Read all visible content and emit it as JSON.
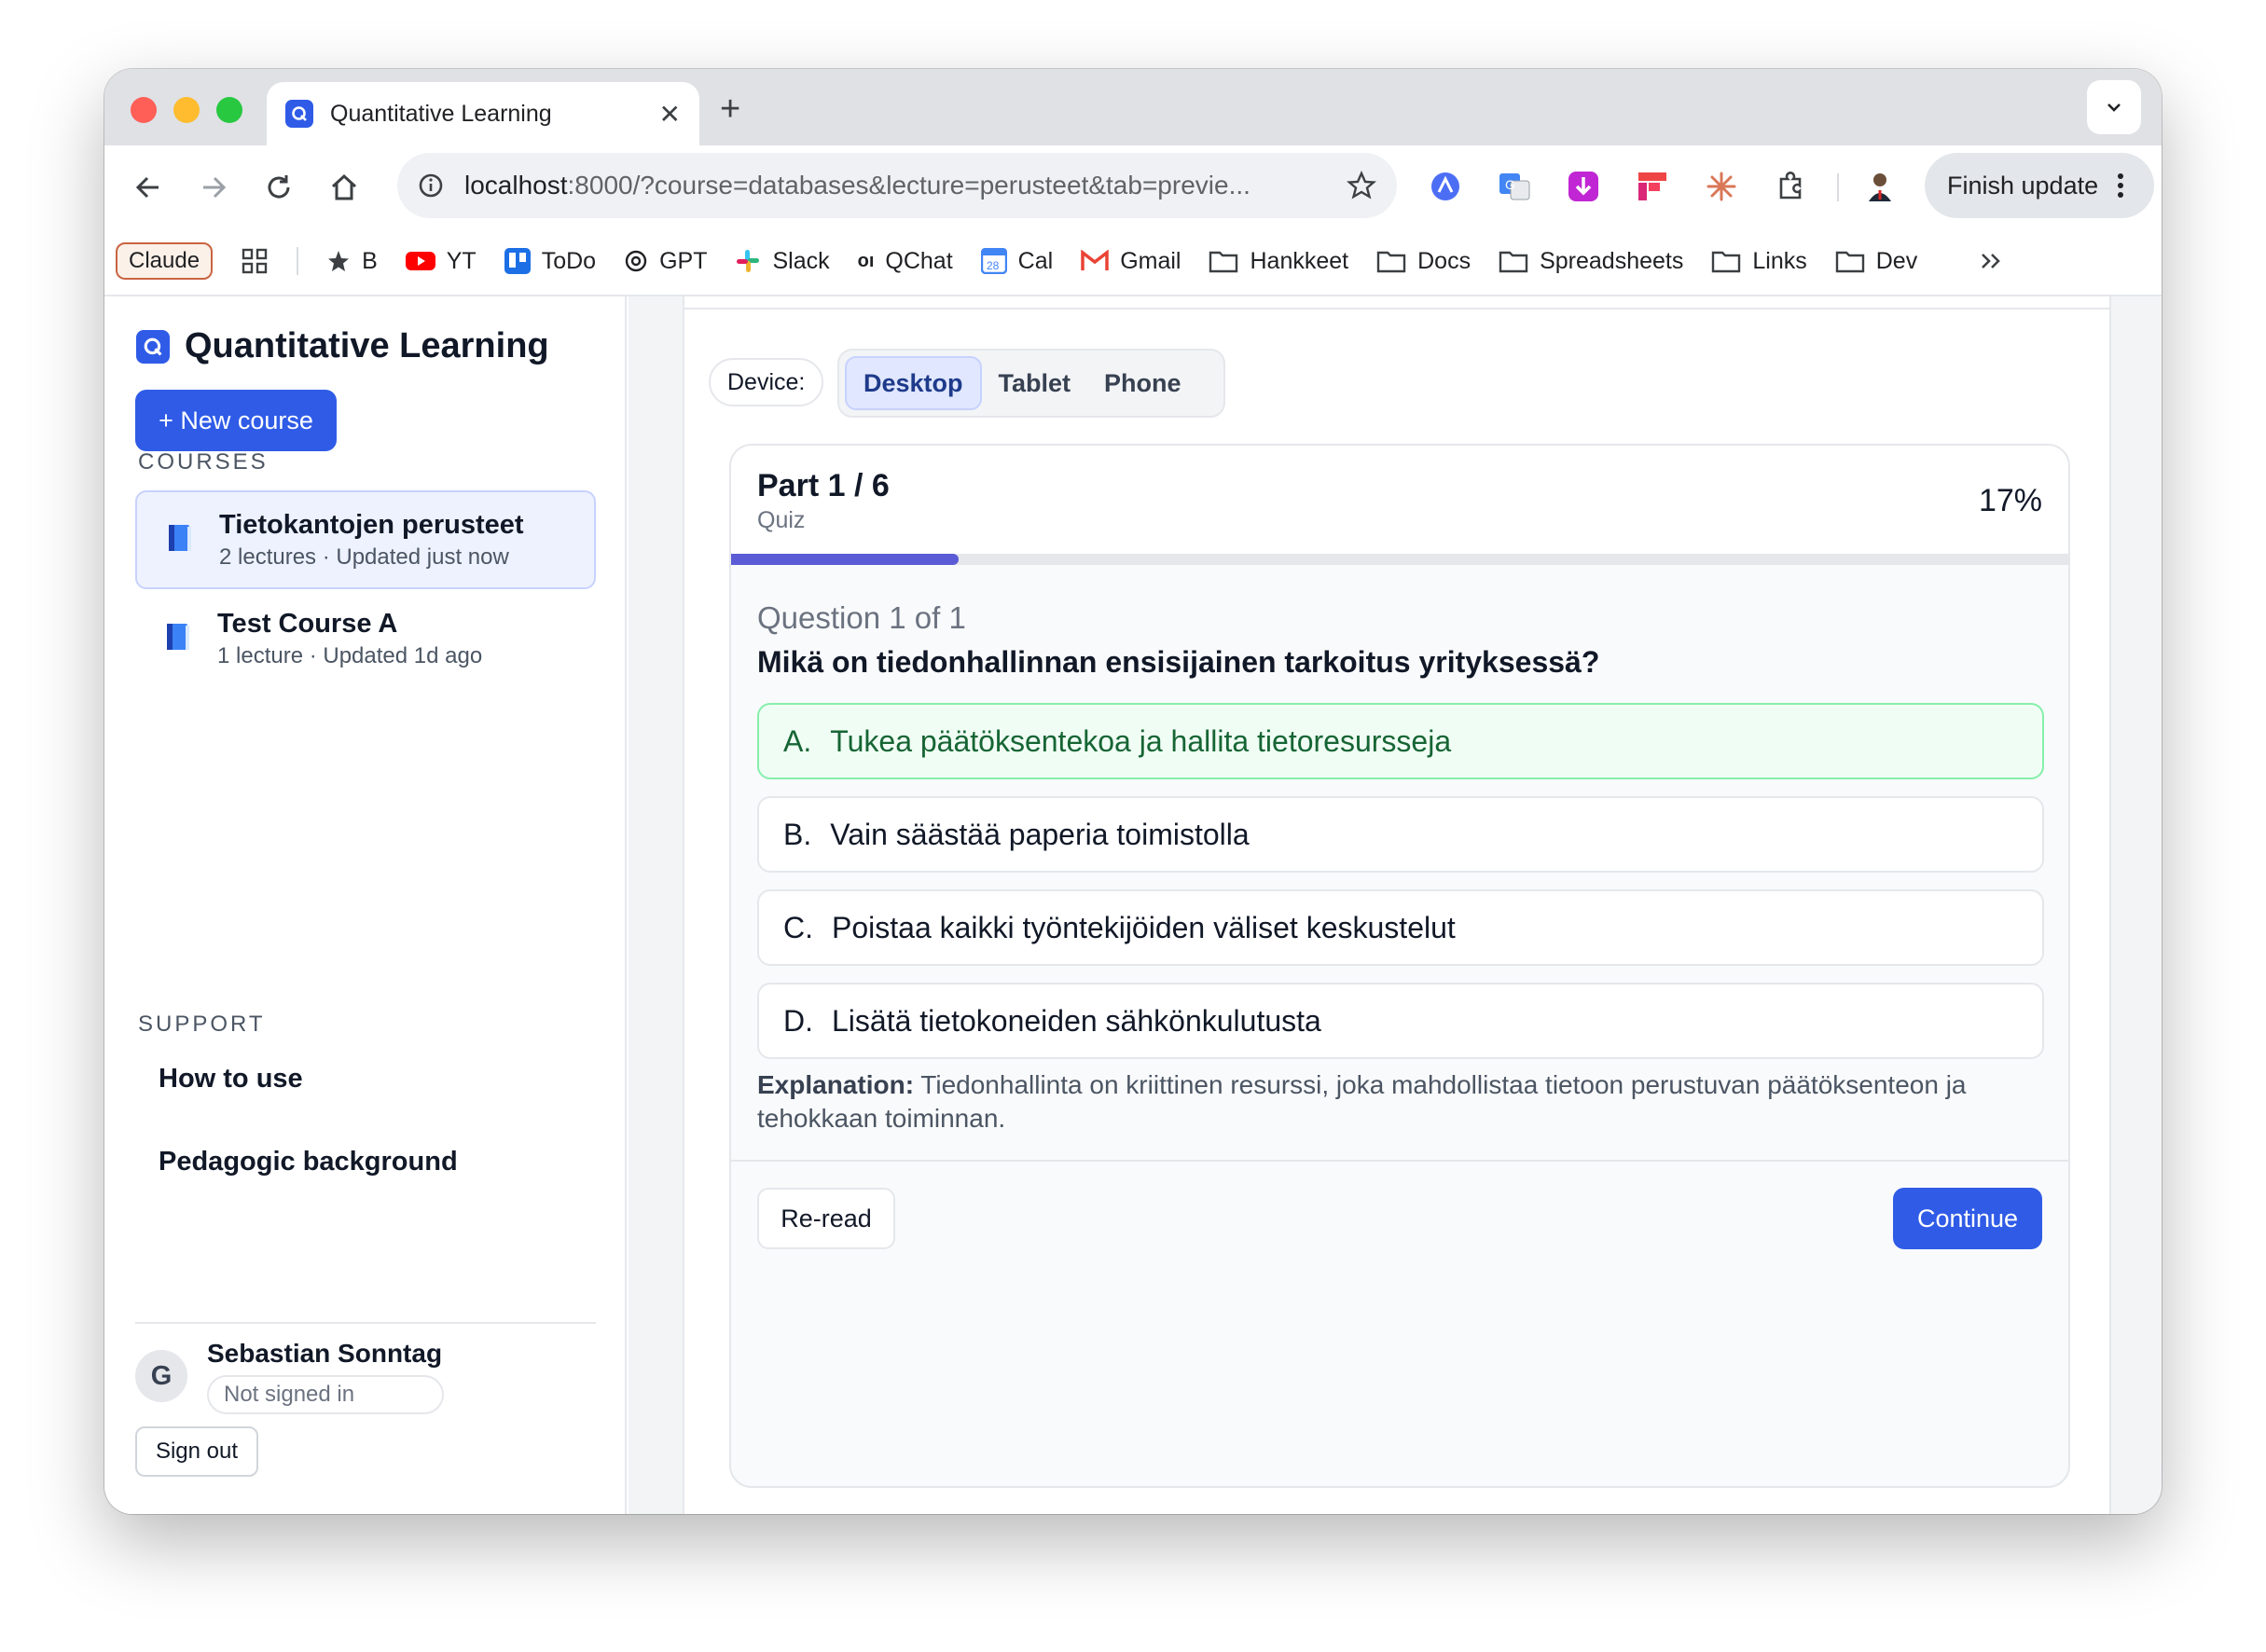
{
  "browser": {
    "tab_title": "Quantitative Learning",
    "url_host": "localhost",
    "url_rest": ":8000/?course=databases&lecture=perusteet&tab=previe...",
    "finish_update": "Finish update"
  },
  "bookmarks": [
    {
      "label": "Claude",
      "icon": "claude-chip"
    },
    {
      "label": "B",
      "icon": "star-icon"
    },
    {
      "label": "YT",
      "icon": "youtube-icon"
    },
    {
      "label": "ToDo",
      "icon": "trello-icon"
    },
    {
      "label": "GPT",
      "icon": "openai-icon"
    },
    {
      "label": "Slack",
      "icon": "slack-icon"
    },
    {
      "label": "QChat",
      "icon": "qchat-icon"
    },
    {
      "label": "Cal",
      "icon": "calendar-icon"
    },
    {
      "label": "Gmail",
      "icon": "gmail-icon"
    },
    {
      "label": "Hankkeet",
      "icon": "folder-icon"
    },
    {
      "label": "Docs",
      "icon": "folder-icon"
    },
    {
      "label": "Spreadsheets",
      "icon": "folder-icon"
    },
    {
      "label": "Links",
      "icon": "folder-icon"
    },
    {
      "label": "Dev",
      "icon": "folder-icon"
    }
  ],
  "sidebar": {
    "brand": "Quantitative Learning",
    "new_course": "+ New course",
    "courses_label": "COURSES",
    "courses": [
      {
        "name": "Tietokantojen perusteet",
        "meta": "2 lectures · Updated just now"
      },
      {
        "name": "Test Course A",
        "meta": "1 lecture · Updated 1d ago"
      }
    ],
    "support_label": "SUPPORT",
    "support_links": [
      "How to use",
      "Pedagogic background"
    ],
    "user": {
      "initial": "G",
      "name": "Sebastian Sonntag",
      "status": "Not signed in"
    },
    "sign_out": "Sign out"
  },
  "preview": {
    "device_label": "Device:",
    "devices": [
      "Desktop",
      "Tablet",
      "Phone"
    ],
    "active_device": "Desktop",
    "part": "Part 1 / 6",
    "part_kind": "Quiz",
    "progress_text": "17%",
    "progress_fraction": 0.17,
    "question_count": "Question 1 of 1",
    "question": "Mikä on tiedonhallinnan ensisijainen tarkoitus yrityksessä?",
    "options": [
      {
        "letter": "A.",
        "text": "Tukea päätöksentekoa ja hallita tietoresursseja",
        "correct": true
      },
      {
        "letter": "B.",
        "text": "Vain säästää paperia toimistolla",
        "correct": false
      },
      {
        "letter": "C.",
        "text": "Poistaa kaikki työntekijöiden väliset keskustelut",
        "correct": false
      },
      {
        "letter": "D.",
        "text": "Lisätä tietokoneiden sähkönkulutusta",
        "correct": false
      }
    ],
    "explanation_label": "Explanation:",
    "explanation": "Tiedonhallinta on kriittinen resurssi, joka mahdollistaa tietoon perustuvan päätöksenteon ja tehokkaan toiminnan.",
    "reread": "Re-read",
    "continue": "Continue"
  },
  "colors": {
    "accent": "#2f5be7",
    "progress": "#5b5bd6",
    "correct_bg": "#f0fdf4",
    "correct_text": "#166534"
  }
}
